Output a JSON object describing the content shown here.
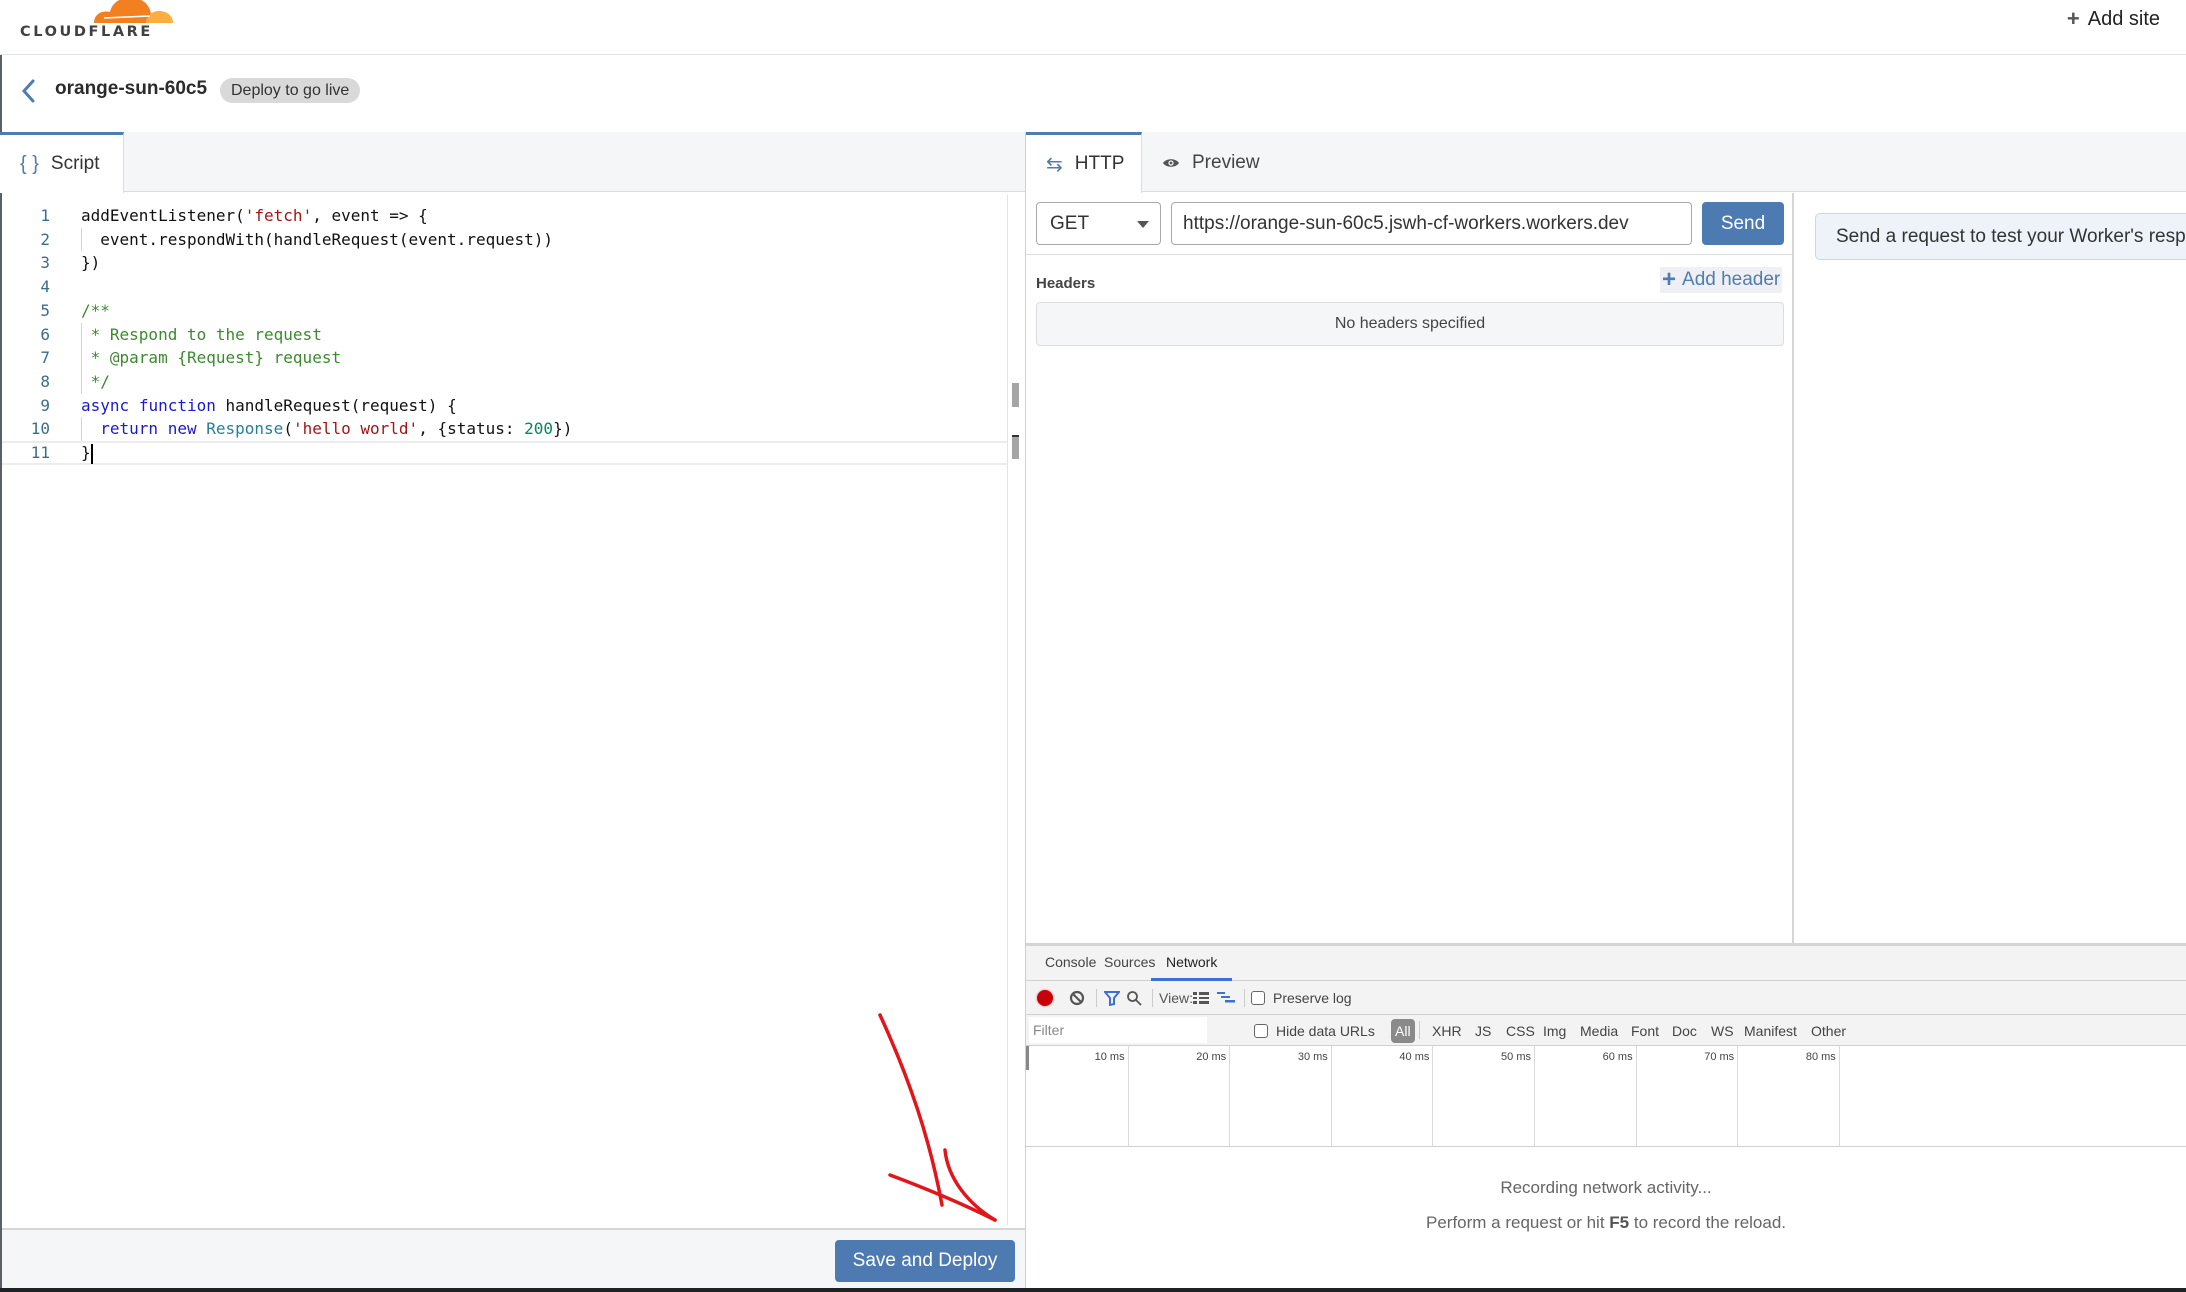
{
  "header": {
    "logo_text": "CLOUDFLARE",
    "add_site_label": "Add site",
    "brand_colors": {
      "orange": "#f38020",
      "light_orange": "#faae40"
    }
  },
  "titlebar": {
    "worker_name": "orange-sun-60c5",
    "status_badge": "Deploy to go live"
  },
  "editor": {
    "tab_label": "Script",
    "tab_icon": "braces-icon",
    "lines": [
      {
        "n": "1",
        "tokens": [
          [
            "",
            "addEventListener("
          ],
          [
            "str",
            "'fetch'"
          ],
          [
            "",
            ", event => {"
          ]
        ]
      },
      {
        "n": "2",
        "tokens": [
          [
            "",
            "  event.respondWith(handleRequest(event.request))"
          ]
        ]
      },
      {
        "n": "3",
        "tokens": [
          [
            "",
            "})"
          ]
        ]
      },
      {
        "n": "4",
        "tokens": []
      },
      {
        "n": "5",
        "tokens": [
          [
            "com",
            "/**"
          ]
        ]
      },
      {
        "n": "6",
        "tokens": [
          [
            "com",
            " * Respond to the request"
          ]
        ]
      },
      {
        "n": "7",
        "tokens": [
          [
            "com",
            " * @param {Request} request"
          ]
        ]
      },
      {
        "n": "8",
        "tokens": [
          [
            "com",
            " */"
          ]
        ]
      },
      {
        "n": "9",
        "tokens": [
          [
            "kw",
            "async"
          ],
          [
            "",
            " "
          ],
          [
            "kw",
            "function"
          ],
          [
            "",
            " handleRequest(request) {"
          ]
        ]
      },
      {
        "n": "10",
        "tokens": [
          [
            "",
            "  "
          ],
          [
            "kw",
            "return"
          ],
          [
            "",
            " "
          ],
          [
            "kw",
            "new"
          ],
          [
            "",
            " "
          ],
          [
            "type",
            "Response"
          ],
          [
            "",
            "("
          ],
          [
            "str",
            "'hello world'"
          ],
          [
            "",
            ", {status: "
          ],
          [
            "num",
            "200"
          ],
          [
            "",
            "})"
          ]
        ]
      },
      {
        "n": "11",
        "tokens": [
          [
            "",
            "}"
          ]
        ]
      }
    ],
    "current_line": 11,
    "save_deploy_label": "Save and Deploy"
  },
  "http": {
    "tabs": [
      {
        "label": "HTTP",
        "icon": "arrows-exchange-icon",
        "active": true
      },
      {
        "label": "Preview",
        "icon": "eye-icon",
        "active": false
      }
    ],
    "method": "GET",
    "url": "https://orange-sun-60c5.jswh-cf-workers.workers.dev",
    "send_label": "Send",
    "headers_label": "Headers",
    "add_header_label": "Add header",
    "no_headers_text": "No headers specified",
    "response_hint": "Send a request to test your Worker's response."
  },
  "devtools": {
    "tabs": [
      {
        "label": "Console",
        "active": false
      },
      {
        "label": "Sources",
        "active": false
      },
      {
        "label": "Network",
        "active": true
      }
    ],
    "view_label": "View:",
    "preserve_log_label": "Preserve log",
    "preserve_log_checked": false,
    "filter_placeholder": "Filter",
    "hide_data_urls_label": "Hide data URLs",
    "hide_data_urls_checked": false,
    "type_filters": [
      "All",
      "XHR",
      "JS",
      "CSS",
      "Img",
      "Media",
      "Font",
      "Doc",
      "WS",
      "Manifest",
      "Other"
    ],
    "active_type_filter": "All",
    "timeline_ticks": [
      "10 ms",
      "20 ms",
      "30 ms",
      "40 ms",
      "50 ms",
      "60 ms",
      "70 ms",
      "80 ms"
    ],
    "recording_text": "Recording network activity...",
    "hint_prefix": "Perform a request or hit ",
    "hint_key": "F5",
    "hint_suffix": " to record the reload."
  }
}
